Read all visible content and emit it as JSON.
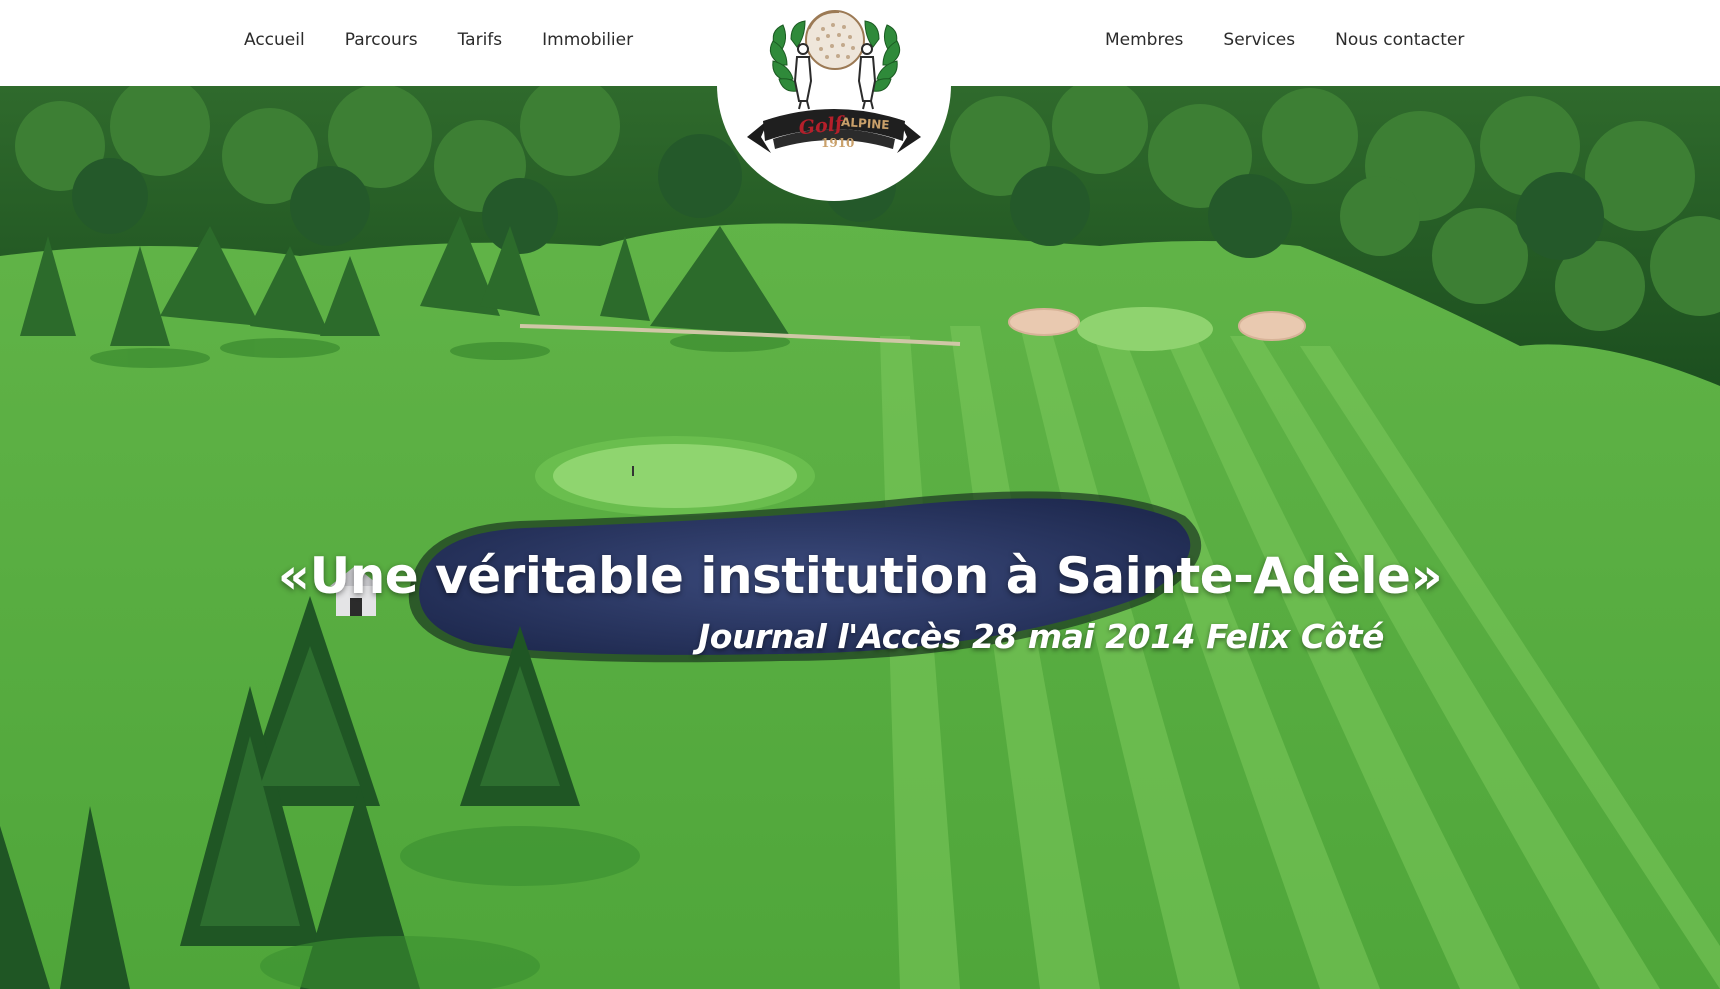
{
  "nav": {
    "left": [
      {
        "label": "Accueil"
      },
      {
        "label": "Parcours"
      },
      {
        "label": "Tarifs"
      },
      {
        "label": "Immobilier"
      }
    ],
    "right": [
      {
        "label": "Membres"
      },
      {
        "label": "Services"
      },
      {
        "label": "Nous contacter"
      }
    ]
  },
  "logo": {
    "word_golf": "Golf",
    "word_alpine": "ALPINE",
    "year": "1910"
  },
  "hero": {
    "quote": "«Une véritable institution à Sainte-Adèle»",
    "citation": "Journal l'Accès 28 mai 2014 Felix Côté"
  },
  "colors": {
    "header_bg": "#ffffff",
    "nav_text": "#2b2b2b",
    "grass": "#5fb548",
    "fairway_stripe": "#7cc95c",
    "forest": "#1e5a23",
    "water": "#2e3a66",
    "sand": "#e9c9b0",
    "logo_red": "#b51f2a",
    "logo_gold": "#c9a06a"
  }
}
